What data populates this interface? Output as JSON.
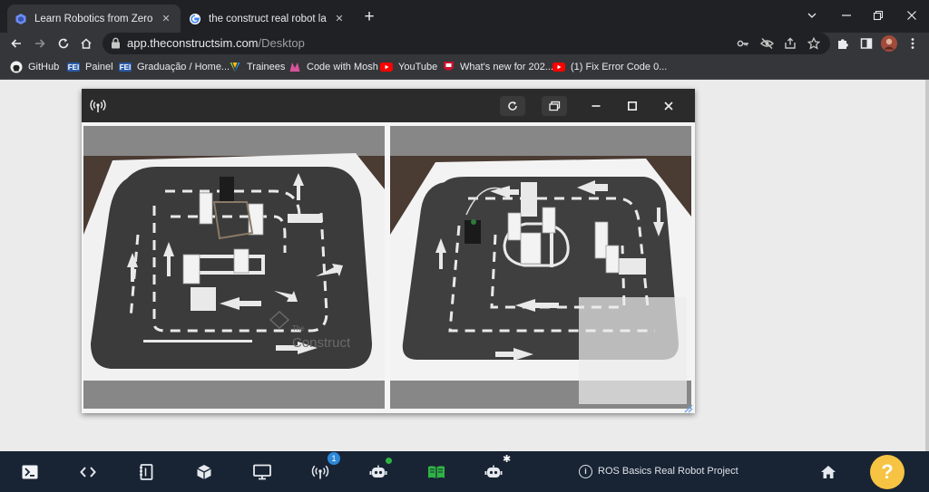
{
  "tabs": [
    {
      "title": "Learn Robotics from Zero - Robo",
      "active": true,
      "icon": "construct-logo-icon"
    },
    {
      "title": "the construct real robot lab joyst",
      "active": false,
      "icon": "google-g-icon"
    }
  ],
  "address_bar": {
    "host": "app.theconstructsim.com",
    "path": "/Desktop"
  },
  "bookmarks": [
    {
      "label": "GitHub",
      "icon": "github-icon"
    },
    {
      "label": "Painel",
      "icon": "fei-icon",
      "icon_text": "FEI"
    },
    {
      "label": "Graduação / Home...",
      "icon": "fei-icon",
      "icon_text": "FEI"
    },
    {
      "label": "Trainees",
      "icon": "trainees-icon"
    },
    {
      "label": "Code with Mosh",
      "icon": "mosh-icon"
    },
    {
      "label": "YouTube",
      "icon": "youtube-icon"
    },
    {
      "label": "What's new for 202...",
      "icon": "harvard-icon"
    },
    {
      "label": "(1) Fix Error Code 0...",
      "icon": "youtube-icon"
    }
  ],
  "camera_window": {
    "feeds": [
      {
        "watermark": "Construct",
        "watermark_small": "The"
      },
      {
        "watermark": "",
        "watermark_small": ""
      }
    ]
  },
  "dock": {
    "notification_count": "1",
    "project_label": "ROS Basics Real Robot Project",
    "help_label": "?",
    "colors": {
      "background": "#182434",
      "help": "#f6c343",
      "badge": "#2d88d8",
      "status_green": "#2fb344",
      "notebook_green": "#2fb344"
    }
  }
}
